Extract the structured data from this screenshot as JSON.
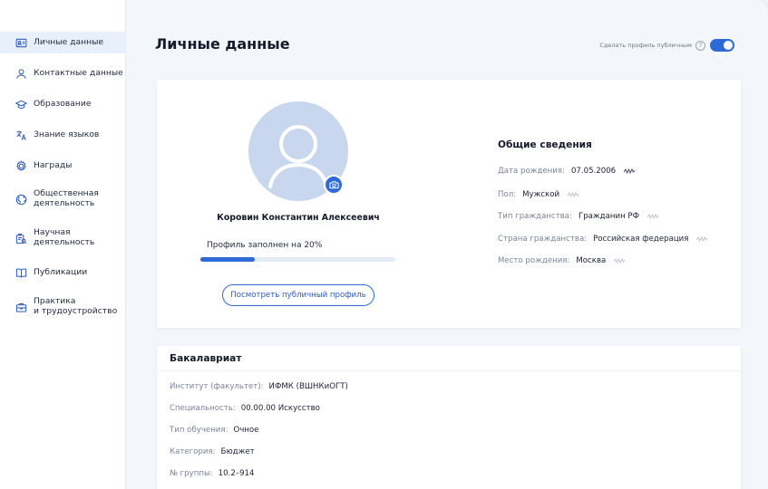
{
  "sidebar": {
    "items": [
      {
        "label": "Личные данные",
        "icon": "id-card-icon",
        "active": true
      },
      {
        "label": "Контактные данные",
        "icon": "person-icon"
      },
      {
        "label": "Образование",
        "icon": "graduation-cap-icon"
      },
      {
        "label": "Знание языков",
        "icon": "translate-icon"
      },
      {
        "label": "Награды",
        "icon": "award-icon"
      },
      {
        "label": "Общественная\nдеятельность",
        "icon": "globe-icon"
      },
      {
        "label": "Научная\nдеятельность",
        "icon": "science-icon"
      },
      {
        "label": "Публикации",
        "icon": "book-icon"
      },
      {
        "label": "Практика\nи трудоустройство",
        "icon": "briefcase-icon"
      }
    ]
  },
  "header": {
    "title": "Личные данные",
    "public_toggle_label": "Сделать профиль публичным",
    "help_glyph": "?",
    "public_toggle_on": true
  },
  "profile": {
    "full_name": "Коровин Константин Алексеевич",
    "completion_text": "Профиль заполнен на 20%",
    "completion_fraction": 0.28,
    "view_public_button": "Посмотреть публичный профиль"
  },
  "general_info": {
    "heading": "Общие сведения",
    "rows": [
      {
        "label": "Дата рождения:",
        "value": "07.05.2006",
        "verified": true
      },
      {
        "label": "Пол:",
        "value": "Мужской",
        "verified": false
      },
      {
        "label": "Тип гражданства:",
        "value": "Гражданин РФ",
        "verified": false
      },
      {
        "label": "Страна гражданства:",
        "value": "Российская федерация",
        "verified": false
      },
      {
        "label": "Место рождения:",
        "value": "Москва",
        "verified": false
      }
    ]
  },
  "education": {
    "title": "Бакалавриат",
    "rows": [
      {
        "label": "Институт (факультет):",
        "value": "ИФМК (ВШНКиОГТ)"
      },
      {
        "label": "Специальность:",
        "value": "00.00.00 Искусство"
      },
      {
        "label": "Тип обучения:",
        "value": "Очное"
      },
      {
        "label": "Категория:",
        "value": "Бюджет"
      },
      {
        "label": "№ группы:",
        "value": "10.2–914"
      }
    ]
  },
  "colors": {
    "accent": "#2e6ad7",
    "avatar_bg": "#c8d6ee",
    "sidebar_active_bg": "#e9f0fb"
  }
}
